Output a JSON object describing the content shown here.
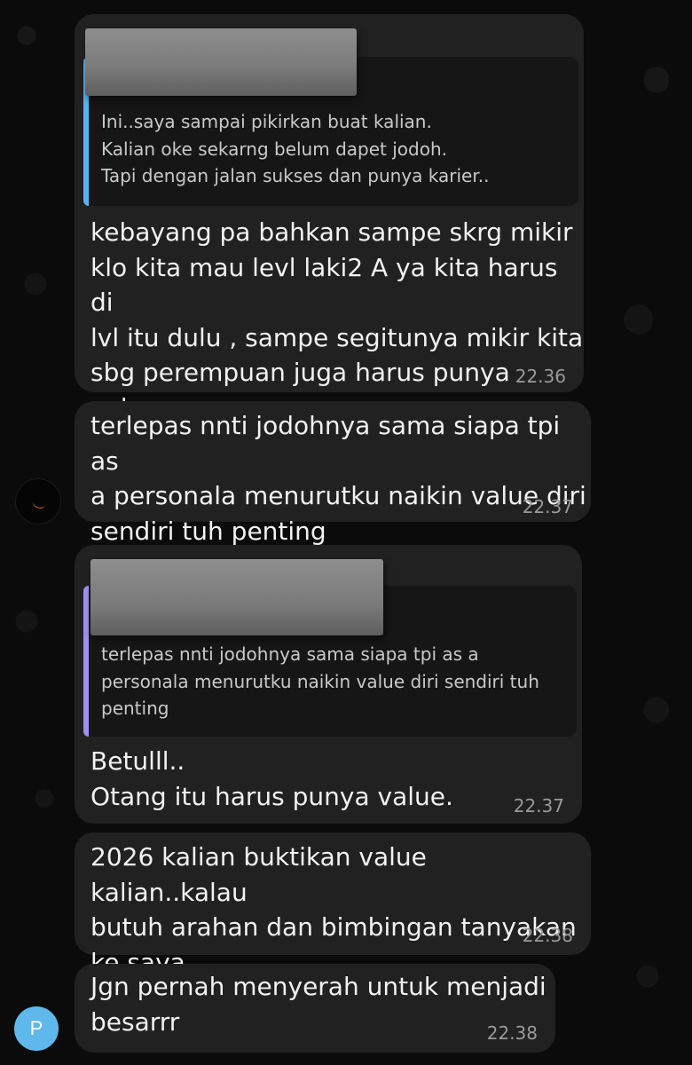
{
  "colors": {
    "bubble": "#212121",
    "quote_bg": "#161616",
    "quote_bar_blue": "#5ab3f0",
    "quote_bar_purple": "#a28ff0",
    "avatar_p": "#5fb8ec"
  },
  "messages": [
    {
      "quote": {
        "text": "Ini..saya sampai pikirkan buat kalian.\nKalian oke sekarng belum dapet jodoh.\nTapi dengan jalan sukses dan punya karier.."
      },
      "text": "kebayang pa bahkan sampe skrg mikir\nklo kita mau levl laki2 A ya kita harus di\nlvl itu dulu , sampe segitunya mikir kita\nsbg perempuan juga harus punya value",
      "time": "22.36"
    },
    {
      "text": "terlepas nnti jodohnya sama siapa tpi as\na personala menurutku naikin value diri\nsendiri tuh penting",
      "time": "22.37"
    },
    {
      "quote": {
        "text": "terlepas nnti jodohnya sama siapa tpi as a\npersonala menurutku naikin value diri sendiri tuh\npenting"
      },
      "text": "Betulll..\nOtang itu harus punya value.",
      "time": "22.37"
    },
    {
      "text": "2026 kalian buktikan value kalian..kalau\nbutuh arahan dan bimbingan tanyakan\nke saya..",
      "time": "22.38"
    },
    {
      "text": "Jgn pernah menyerah untuk menjadi\nbesarrr",
      "time": "22.38"
    }
  ],
  "avatars": {
    "p_letter": "P"
  }
}
